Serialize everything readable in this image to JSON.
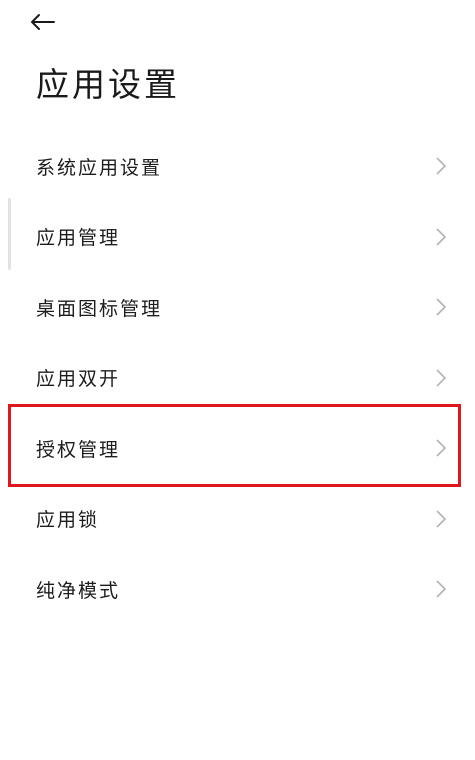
{
  "header": {
    "back_icon": "arrow-left-icon",
    "title": "应用设置"
  },
  "settings": {
    "items": [
      {
        "label": "系统应用设置"
      },
      {
        "label": "应用管理"
      },
      {
        "label": "桌面图标管理"
      },
      {
        "label": "应用双开"
      },
      {
        "label": "授权管理"
      },
      {
        "label": "应用锁"
      },
      {
        "label": "纯净模式"
      }
    ],
    "chevron_icon": "chevron-right-icon"
  },
  "colors": {
    "highlight": "#e0161e",
    "chevron": "#b3b3b3",
    "text": "#1c1c1c"
  }
}
